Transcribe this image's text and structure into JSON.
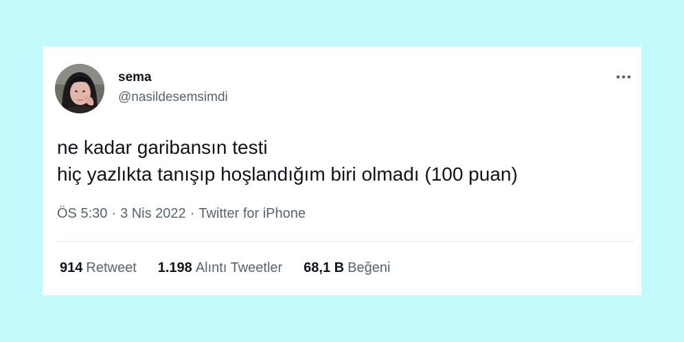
{
  "colors": {
    "background": "#c3fbfd",
    "card": "#ffffff",
    "primary_text": "#0f1419",
    "secondary_text": "#536471",
    "divider": "#e4e8eb"
  },
  "tweet": {
    "author": {
      "display_name": "sema",
      "handle": "@nasildesemsimdi",
      "avatar_icon": "profile-photo"
    },
    "more_icon": "more-horizontal-icon",
    "text_lines": [
      "ne kadar garibansın testi",
      "hiç yazlıkta tanışıp hoşlandığım biri olmadı (100 puan)"
    ],
    "meta": {
      "time": "ÖS 5:30",
      "separator": "·",
      "date": "3 Nis 2022",
      "source": "Twitter for iPhone"
    },
    "stats": {
      "retweets": {
        "count": "914",
        "label": "Retweet"
      },
      "quotes": {
        "count": "1.198",
        "label": "Alıntı Tweetler"
      },
      "likes": {
        "count": "68,1 B",
        "label": "Beğeni"
      }
    }
  }
}
